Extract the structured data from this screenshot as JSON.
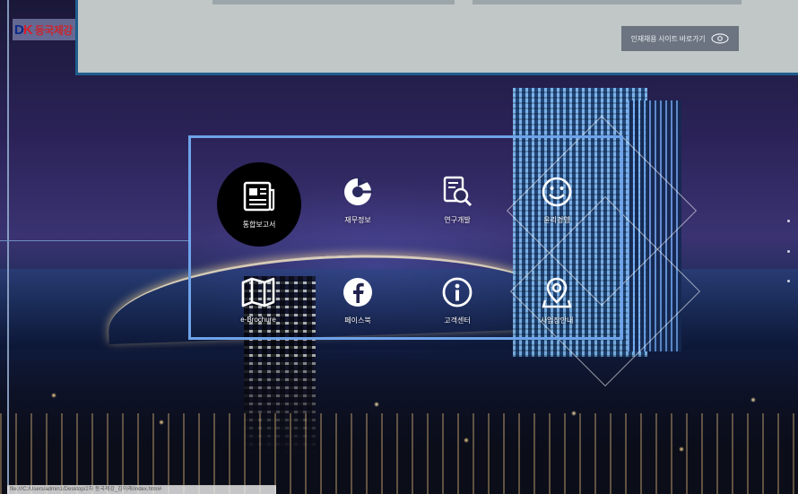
{
  "logo": {
    "mark_d": "D",
    "mark_k": "K",
    "text": "동국제강"
  },
  "top_panel": {
    "site_button_label": "인재채용 사이트 바로가기",
    "site_button_icon": "eye-icon"
  },
  "quick_links": [
    {
      "label": "통합보고서",
      "icon": "report-icon",
      "active": true
    },
    {
      "label": "재무정보",
      "icon": "pie-chart-icon",
      "active": false
    },
    {
      "label": "연구개발",
      "icon": "research-icon",
      "active": false
    },
    {
      "label": "윤리경영",
      "icon": "smile-icon",
      "active": false
    },
    {
      "label": "e-Brochure",
      "icon": "map-book-icon",
      "active": false
    },
    {
      "label": "페이스북",
      "icon": "facebook-icon",
      "active": false
    },
    {
      "label": "고객센터",
      "icon": "info-icon",
      "active": false
    },
    {
      "label": "사업장안내",
      "icon": "location-icon",
      "active": false
    }
  ],
  "status_bar": {
    "url": "file:///C:/Users/admin1/Desktop/2차 동국제강_김이래/index.html#"
  },
  "colors": {
    "grid_border": "#6ea3ea",
    "panel_bg": "#c0c7c6",
    "panel_border": "#1f5e8e",
    "button_bg": "#6b7480",
    "logo_red": "#c9262f",
    "logo_navy": "#0c2a86"
  }
}
